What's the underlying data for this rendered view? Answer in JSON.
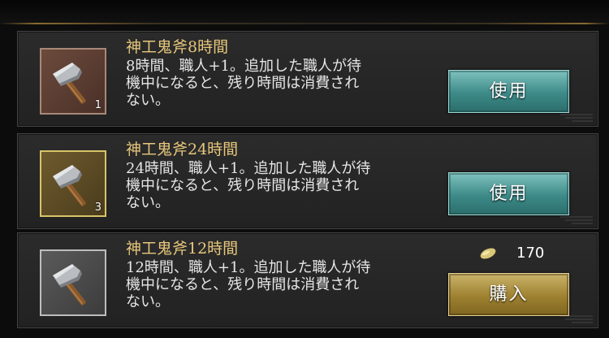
{
  "items": [
    {
      "title": "神工鬼斧8時間",
      "desc_line1": "8時間、職人+1。追加した職人が待",
      "desc_line2": "機中になると、残り時間は消費され",
      "desc_line3": "ない。",
      "count": "1",
      "icon": "hammer-icon",
      "button_label": "使用"
    },
    {
      "title": "神工鬼斧24時間",
      "desc_line1": "24時間、職人+1。追加した職人が待",
      "desc_line2": "機中になると、残り時間は消費され",
      "desc_line3": "ない。",
      "count": "3",
      "icon": "hammer-icon",
      "button_label": "使用"
    },
    {
      "title": "神工鬼斧12時間",
      "desc_line1": "12時間、職人+1。追加した職人が待",
      "desc_line2": "機中になると、残り時間は消費され",
      "desc_line3": "ない。",
      "icon": "hammer-icon",
      "price_icon": "gold-ingot-icon",
      "price": "170",
      "button_label": "購入"
    }
  ],
  "colors": {
    "title": "#e7c77b",
    "use_button": "#4a9c98",
    "buy_button": "#a88a36"
  }
}
